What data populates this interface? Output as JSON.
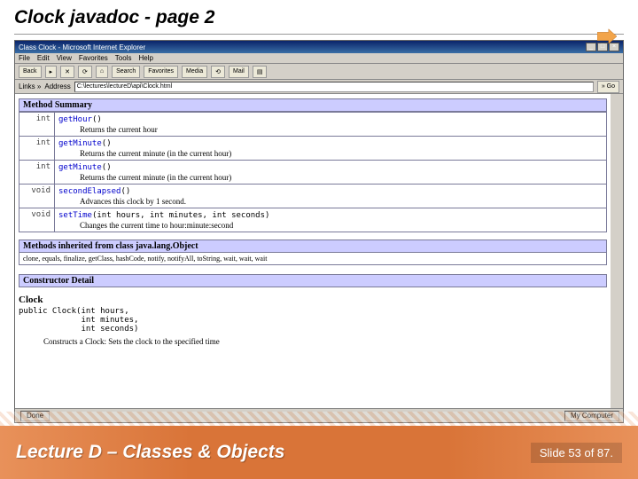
{
  "slide": {
    "title": "Clock javadoc - page 2",
    "lecture": "Lecture D – Classes & Objects",
    "slideNumber": "Slide 53 of 87."
  },
  "browser": {
    "windowTitle": "Class Clock - Microsoft Internet Explorer",
    "menu": {
      "file": "File",
      "edit": "Edit",
      "view": "View",
      "favorites": "Favorites",
      "tools": "Tools",
      "help": "Help"
    },
    "toolbar": {
      "back": "Back",
      "forward": "▸",
      "stop": "✕",
      "refresh": "⟳",
      "home": "⌂",
      "search": "Search",
      "favorites": "Favorites",
      "media": "Media",
      "history": "⟲",
      "mail": "Mail",
      "print": "▤"
    },
    "addr": {
      "linksLabel": "Links »",
      "addressLabel": "Address",
      "url": "C:\\lectures\\lectureD\\api\\Clock.html",
      "goLabel": "» Go"
    },
    "status": {
      "done": "Done",
      "zone": "My Computer"
    }
  },
  "javadoc": {
    "methodSummaryHeader": "Method Summary",
    "methods": [
      {
        "ret": "int",
        "name": "getHour",
        "sig": "()",
        "desc": "Returns the current hour"
      },
      {
        "ret": "int",
        "name": "getMinute",
        "sig": "()",
        "desc": "Returns the current minute (in the current hour)"
      },
      {
        "ret": "int",
        "name": "getMinute",
        "sig": "()",
        "desc": "Returns the current minute (in the current hour)"
      },
      {
        "ret": "void",
        "name": "secondElapsed",
        "sig": "()",
        "desc": "Advances this clock by 1 second."
      },
      {
        "ret": "void",
        "name": "setTime",
        "sig": "(int hours, int minutes, int seconds)",
        "desc": "Changes the current time to hour:minute:second"
      }
    ],
    "inheritedHeader": "Methods inherited from class java.lang.Object",
    "inheritedList": "clone, equals, finalize, getClass, hashCode, notify, notifyAll, toString, wait, wait, wait",
    "constructorDetailHeader": "Constructor Detail",
    "constructor": {
      "name": "Clock",
      "sig": "public Clock(int hours,\n             int minutes,\n             int seconds)",
      "desc": "Constructs a Clock: Sets the clock to the specified time"
    }
  }
}
